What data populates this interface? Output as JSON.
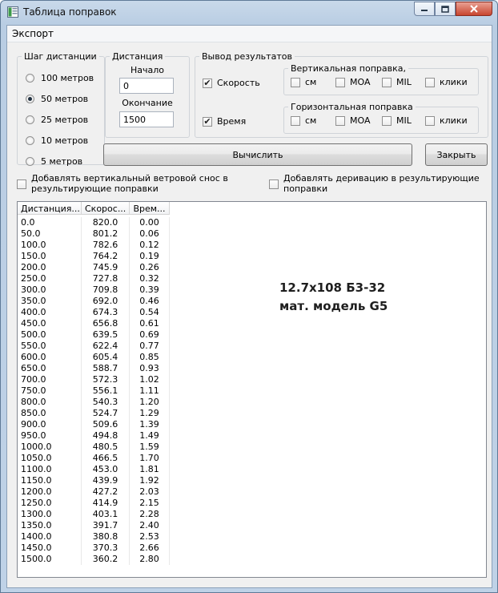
{
  "window": {
    "title": "Таблица поправок",
    "minimize_glyph": "—",
    "maximize_glyph": "□",
    "close_glyph": "✕"
  },
  "menu": {
    "export_label": "Экспорт"
  },
  "step_group": {
    "legend": "Шаг дистанции",
    "options": [
      "100 метров",
      "50 метров",
      "25 метров",
      "10 метров",
      "5 метров"
    ],
    "selected": "50 метров"
  },
  "distance_group": {
    "legend": "Дистанция",
    "start_label": "Начало",
    "start_value": "0",
    "end_label": "Окончание",
    "end_value": "1500"
  },
  "output_group": {
    "legend": "Вывод результатов",
    "speed_label": "Скорость",
    "speed_checked": true,
    "time_label": "Время",
    "time_checked": true,
    "vertical": {
      "legend": "Вертикальная поправка,",
      "units": [
        "см",
        "MOA",
        "MIL",
        "клики"
      ]
    },
    "horizontal": {
      "legend": "Горизонтальная поправка",
      "units": [
        "см",
        "MOA",
        "MIL",
        "клики"
      ]
    }
  },
  "buttons": {
    "calculate": "Вычислить",
    "close": "Закрыть"
  },
  "options": {
    "wind_drift_line1": "Добавлять вертикальный ветровой снос в",
    "wind_drift_line2": "результирующие поправки",
    "derivation_line1": "Добавлять деривацию в результирующие",
    "derivation_line2": "поправки"
  },
  "table": {
    "headers": [
      "Дистанция...",
      "Скорос...",
      "Врем..."
    ],
    "rows": [
      [
        "0.0",
        "820.0",
        "0.00"
      ],
      [
        "50.0",
        "801.2",
        "0.06"
      ],
      [
        "100.0",
        "782.6",
        "0.12"
      ],
      [
        "150.0",
        "764.2",
        "0.19"
      ],
      [
        "200.0",
        "745.9",
        "0.26"
      ],
      [
        "250.0",
        "727.8",
        "0.32"
      ],
      [
        "300.0",
        "709.8",
        "0.39"
      ],
      [
        "350.0",
        "692.0",
        "0.46"
      ],
      [
        "400.0",
        "674.3",
        "0.54"
      ],
      [
        "450.0",
        "656.8",
        "0.61"
      ],
      [
        "500.0",
        "639.5",
        "0.69"
      ],
      [
        "550.0",
        "622.4",
        "0.77"
      ],
      [
        "600.0",
        "605.4",
        "0.85"
      ],
      [
        "650.0",
        "588.7",
        "0.93"
      ],
      [
        "700.0",
        "572.3",
        "1.02"
      ],
      [
        "750.0",
        "556.1",
        "1.11"
      ],
      [
        "800.0",
        "540.3",
        "1.20"
      ],
      [
        "850.0",
        "524.7",
        "1.29"
      ],
      [
        "900.0",
        "509.6",
        "1.39"
      ],
      [
        "950.0",
        "494.8",
        "1.49"
      ],
      [
        "1000.0",
        "480.5",
        "1.59"
      ],
      [
        "1050.0",
        "466.5",
        "1.70"
      ],
      [
        "1100.0",
        "453.0",
        "1.81"
      ],
      [
        "1150.0",
        "439.9",
        "1.92"
      ],
      [
        "1200.0",
        "427.2",
        "2.03"
      ],
      [
        "1250.0",
        "414.9",
        "2.15"
      ],
      [
        "1300.0",
        "403.1",
        "2.28"
      ],
      [
        "1350.0",
        "391.7",
        "2.40"
      ],
      [
        "1400.0",
        "380.8",
        "2.53"
      ],
      [
        "1450.0",
        "370.3",
        "2.66"
      ],
      [
        "1500.0",
        "360.2",
        "2.80"
      ]
    ]
  },
  "annotation": {
    "line1": "12.7x108 Б3-32",
    "line2": "мат. модель G5"
  }
}
